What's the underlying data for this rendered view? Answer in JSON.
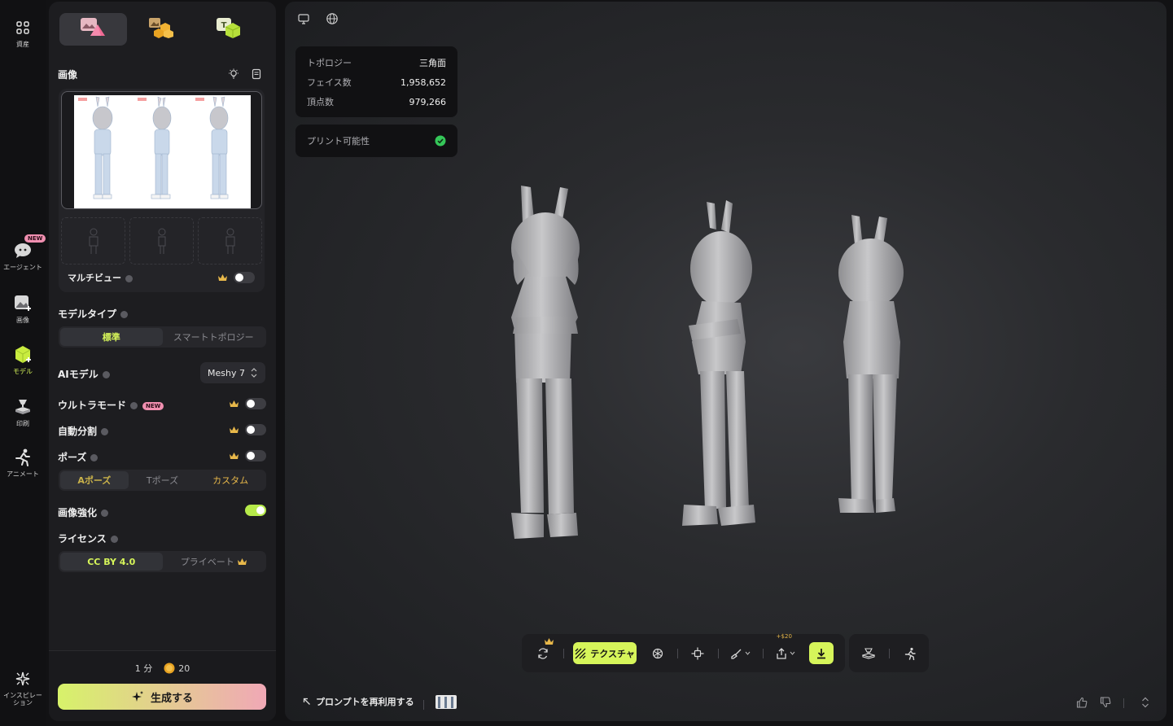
{
  "rail": {
    "assets_label": "資産",
    "agent_label": "エージェント",
    "agent_badge": "NEW",
    "image_label": "画像",
    "model_label": "モデル",
    "print_label": "印刷",
    "animate_label": "アニメート",
    "inspiration_label": "インスピレーション"
  },
  "panel": {
    "image_section_title": "画像",
    "multiview_label": "マルチビュー",
    "model_type": {
      "title": "モデルタイプ",
      "options": [
        "標準",
        "スマートトポロジー"
      ],
      "selected": "標準"
    },
    "ai_model": {
      "title": "AIモデル",
      "value": "Meshy 7"
    },
    "ultra_mode": {
      "title": "ウルトラモード",
      "badge": "NEW",
      "enabled": false
    },
    "auto_split": {
      "title": "自動分割",
      "enabled": false
    },
    "pose": {
      "title": "ポーズ",
      "enabled": false,
      "options": [
        "Aポーズ",
        "Tポーズ",
        "カスタム"
      ],
      "selected": "Aポーズ"
    },
    "image_enhance": {
      "title": "画像強化",
      "enabled": true
    },
    "license": {
      "title": "ライセンス",
      "options": [
        "CC BY 4.0",
        "プライベート"
      ],
      "selected": "CC BY 4.0"
    },
    "generate": {
      "time": "1 分",
      "credits": "20",
      "button_label": "生成する"
    }
  },
  "viewport": {
    "stats": [
      {
        "key": "トポロジー",
        "value": "三角面"
      },
      {
        "key": "フェイス数",
        "value": "1,958,652"
      },
      {
        "key": "頂点数",
        "value": "979,266"
      }
    ],
    "printability_label": "プリント可能性",
    "toolbar": {
      "texture_label": "テクスチャ",
      "export_price": "+$20"
    },
    "reuse_prompt_label": "プロンプトを再利用する"
  },
  "colors": {
    "accent": "#d6f55a",
    "badge_pink": "#f08fb0",
    "gold": "#e8b84a"
  }
}
